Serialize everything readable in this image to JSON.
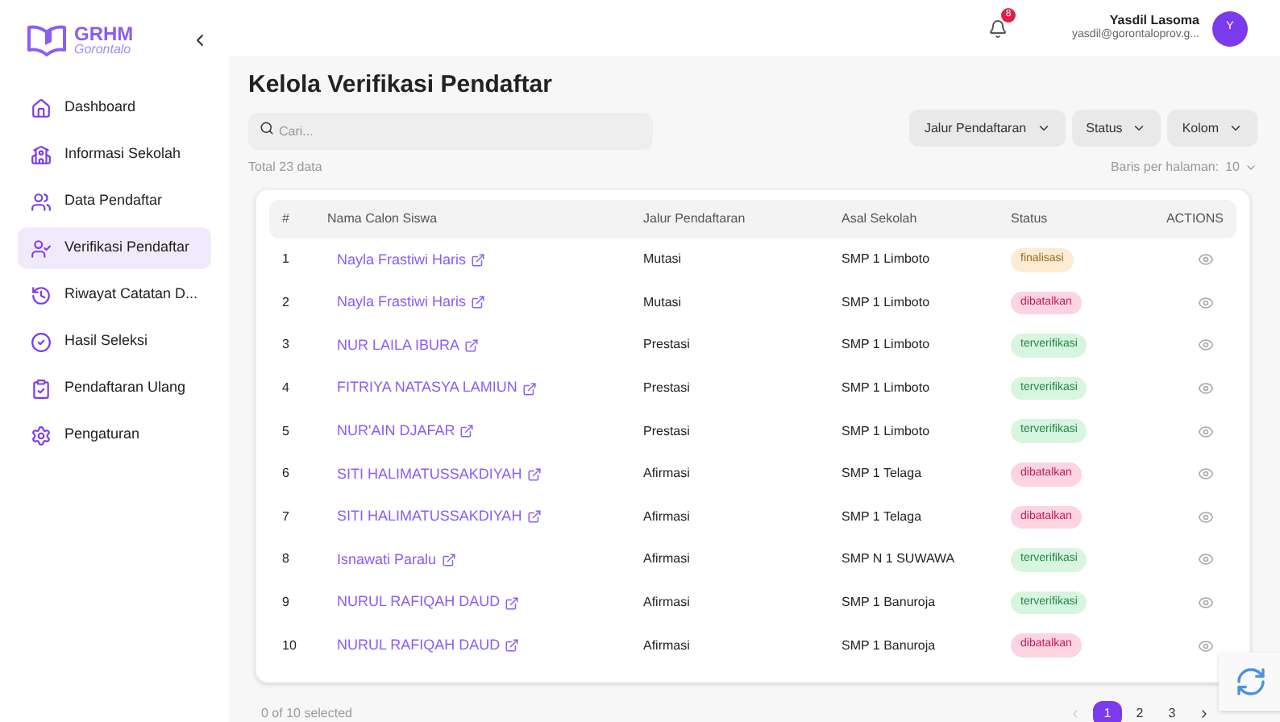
{
  "logo": {
    "title": "GRHM",
    "subtitle": "Gorontalo"
  },
  "sidebar": {
    "items": [
      {
        "label": "Dashboard",
        "selected": false
      },
      {
        "label": "Informasi Sekolah",
        "selected": false
      },
      {
        "label": "Data Pendaftar",
        "selected": false
      },
      {
        "label": "Verifikasi Pendaftar",
        "selected": true
      },
      {
        "label": "Riwayat Catatan D...",
        "selected": false
      },
      {
        "label": "Hasil Seleksi",
        "selected": false
      },
      {
        "label": "Pendaftaran Ulang",
        "selected": false
      },
      {
        "label": "Pengaturan",
        "selected": false
      }
    ]
  },
  "header": {
    "notification_count": "8",
    "user": {
      "name": "Yasdil Lasoma",
      "email": "yasdil@gorontaloprov.g...",
      "initial": "Y"
    }
  },
  "page": {
    "title": "Kelola Verifikasi Pendaftar",
    "search": {
      "placeholder": "Cari..."
    },
    "filters": [
      "Jalur Pendaftaran",
      "Status",
      "Kolom"
    ],
    "total": "Total 23 data",
    "rows_per_page": {
      "label": "Baris per halaman:",
      "value": "10"
    }
  },
  "table": {
    "columns": [
      "#",
      "Nama Calon Siswa",
      "Jalur Pendaftaran",
      "Asal Sekolah",
      "Status",
      "ACTIONS"
    ],
    "rows": [
      {
        "no": "1",
        "name": "Nayla Frastiwi Haris",
        "jalur": "Mutasi",
        "school": "SMP 1 Limboto",
        "status": {
          "label": "finalisasi",
          "kind": "final"
        }
      },
      {
        "no": "2",
        "name": "Nayla Frastiwi Haris",
        "jalur": "Mutasi",
        "school": "SMP 1 Limboto",
        "status": {
          "label": "dibatalkan",
          "kind": "cancel"
        }
      },
      {
        "no": "3",
        "name": "NUR LAILA IBURA",
        "jalur": "Prestasi",
        "school": "SMP 1 Limboto",
        "status": {
          "label": "terverifikasi",
          "kind": "ok"
        }
      },
      {
        "no": "4",
        "name": "FITRIYA NATASYA LAMIUN",
        "jalur": "Prestasi",
        "school": "SMP 1 Limboto",
        "status": {
          "label": "terverifikasi",
          "kind": "ok"
        }
      },
      {
        "no": "5",
        "name": "NUR'AIN DJAFAR",
        "jalur": "Prestasi",
        "school": "SMP 1 Limboto",
        "status": {
          "label": "terverifikasi",
          "kind": "ok"
        }
      },
      {
        "no": "6",
        "name": "SITI HALIMATUSSAKDIYAH",
        "jalur": "Afirmasi",
        "school": "SMP 1 Telaga",
        "status": {
          "label": "dibatalkan",
          "kind": "cancel"
        }
      },
      {
        "no": "7",
        "name": "SITI HALIMATUSSAKDIYAH",
        "jalur": "Afirmasi",
        "school": "SMP 1 Telaga",
        "status": {
          "label": "dibatalkan",
          "kind": "cancel"
        }
      },
      {
        "no": "8",
        "name": "Isnawati Paralu",
        "jalur": "Afirmasi",
        "school": "SMP N 1 SUWAWA",
        "status": {
          "label": "terverifikasi",
          "kind": "ok"
        }
      },
      {
        "no": "9",
        "name": "NURUL RAFIQAH DAUD",
        "jalur": "Afirmasi",
        "school": "SMP 1 Banuroja",
        "status": {
          "label": "terverifikasi",
          "kind": "ok"
        }
      },
      {
        "no": "10",
        "name": "NURUL RAFIQAH DAUD",
        "jalur": "Afirmasi",
        "school": "SMP 1 Banuroja",
        "status": {
          "label": "dibatalkan",
          "kind": "cancel"
        }
      }
    ]
  },
  "footer": {
    "selection": "0 of 10 selected",
    "pages": [
      {
        "label": "1",
        "selected": true
      },
      {
        "label": "2",
        "selected": false
      },
      {
        "label": "3",
        "selected": false
      }
    ]
  }
}
